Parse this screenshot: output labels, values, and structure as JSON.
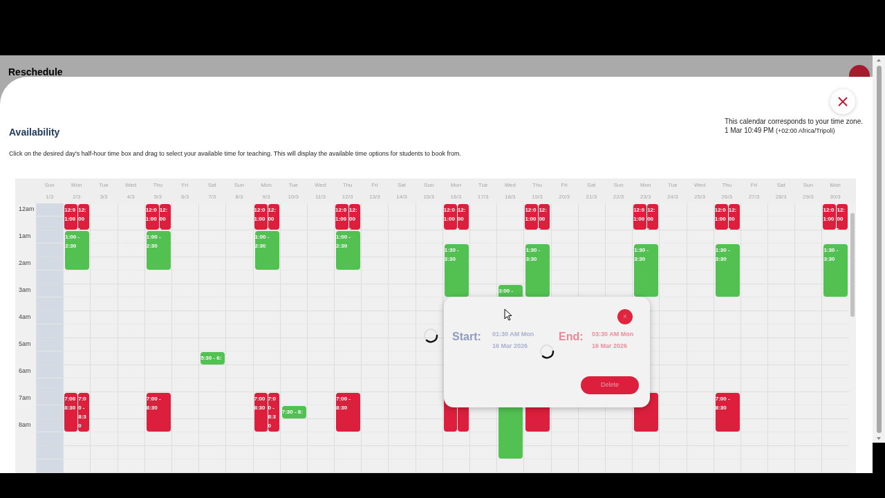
{
  "backdrop": {
    "title": "Reschedule"
  },
  "modal": {
    "heading": "Availability",
    "instructions": "Click on the desired day's half-hour time box and drag to select your available time for teaching. This will display the available time options for students to book from.",
    "timezone_note": "This calendar corresponds to your time zone.",
    "current_time": "1 Mar 10:49 PM",
    "timezone": "(+02:00 Africa/Tripoli)"
  },
  "hours": [
    "12am",
    "1am",
    "2am",
    "3am",
    "4am",
    "5am",
    "6am",
    "7am",
    "8am"
  ],
  "days": [
    {
      "name": "Sun",
      "date": "1/3",
      "past": true
    },
    {
      "name": "Mon",
      "date": "2/3",
      "past": false,
      "slots": [
        {
          "kind": "pair",
          "parts": [
            {
              "lines": [
                "12:0",
                "1:00"
              ]
            },
            {
              "lines": [
                "12:",
                "00",
                "-"
              ]
            }
          ]
        },
        {
          "kind": "cont"
        },
        {
          "kind": "available",
          "lines": [
            "1:00 -",
            "2:30"
          ]
        },
        {
          "kind": "cont"
        },
        {
          "kind": "cont"
        },
        {
          "kind": "free"
        },
        {
          "kind": "free"
        },
        {
          "kind": "free"
        },
        {
          "kind": "free"
        },
        {
          "kind": "free"
        },
        {
          "kind": "free"
        },
        {
          "kind": "free"
        },
        {
          "kind": "free"
        },
        {
          "kind": "free"
        },
        {
          "kind": "pair",
          "parts": [
            {
              "lines": [
                "7:00",
                "8:30"
              ]
            },
            {
              "lines": [
                "7:0",
                "0 -",
                "8:3",
                "0"
              ]
            }
          ]
        },
        {
          "kind": "cont"
        },
        {
          "kind": "cont"
        }
      ]
    },
    {
      "name": "Tue",
      "date": "3/3",
      "past": false
    },
    {
      "name": "Wed",
      "date": "4/3",
      "past": false
    },
    {
      "name": "Thu",
      "date": "5/3",
      "past": false,
      "slots": [
        {
          "kind": "pair",
          "parts": [
            {
              "lines": [
                "12:0",
                "1:00"
              ]
            },
            {
              "lines": [
                "12:",
                "00",
                "-"
              ]
            }
          ]
        },
        {
          "kind": "cont"
        },
        {
          "kind": "available",
          "lines": [
            "1:00 -",
            "2:30"
          ]
        },
        {
          "kind": "cont"
        },
        {
          "kind": "cont"
        },
        {
          "kind": "free"
        },
        {
          "kind": "free"
        },
        {
          "kind": "free"
        },
        {
          "kind": "free"
        },
        {
          "kind": "free"
        },
        {
          "kind": "free"
        },
        {
          "kind": "free"
        },
        {
          "kind": "free"
        },
        {
          "kind": "free"
        },
        {
          "kind": "booked",
          "lines": [
            "7:00 -",
            "8:30"
          ]
        },
        {
          "kind": "cont"
        },
        {
          "kind": "cont"
        }
      ]
    },
    {
      "name": "Fri",
      "date": "6/3",
      "past": false
    },
    {
      "name": "Sat",
      "date": "7/3",
      "past": false,
      "slots": [
        {
          "kind": "free"
        },
        {
          "kind": "free"
        },
        {
          "kind": "free"
        },
        {
          "kind": "free"
        },
        {
          "kind": "free"
        },
        {
          "kind": "free"
        },
        {
          "kind": "free"
        },
        {
          "kind": "free"
        },
        {
          "kind": "free"
        },
        {
          "kind": "free"
        },
        {
          "kind": "free"
        },
        {
          "kind": "available",
          "lines": [
            "5:30 - 6:"
          ]
        }
      ]
    },
    {
      "name": "Sun",
      "date": "8/3",
      "past": false
    },
    {
      "name": "Mon",
      "date": "9/3",
      "past": false,
      "slots": [
        {
          "kind": "pair",
          "parts": [
            {
              "lines": [
                "12:0",
                "1:00"
              ]
            },
            {
              "lines": [
                "12:",
                "00",
                "-"
              ]
            }
          ]
        },
        {
          "kind": "cont"
        },
        {
          "kind": "available",
          "lines": [
            "1:00 -",
            "2:30"
          ]
        },
        {
          "kind": "cont"
        },
        {
          "kind": "cont"
        },
        {
          "kind": "free"
        },
        {
          "kind": "free"
        },
        {
          "kind": "free"
        },
        {
          "kind": "free"
        },
        {
          "kind": "free"
        },
        {
          "kind": "free"
        },
        {
          "kind": "free"
        },
        {
          "kind": "free"
        },
        {
          "kind": "free"
        },
        {
          "kind": "pair",
          "parts": [
            {
              "lines": [
                "7:00",
                "8:30"
              ]
            },
            {
              "lines": [
                "7:0",
                "0 -",
                "8:3",
                "0"
              ]
            }
          ]
        },
        {
          "kind": "cont"
        },
        {
          "kind": "cont"
        }
      ]
    },
    {
      "name": "Tue",
      "date": "10/3",
      "past": false,
      "slots": [
        {
          "kind": "free"
        },
        {
          "kind": "free"
        },
        {
          "kind": "free"
        },
        {
          "kind": "free"
        },
        {
          "kind": "free"
        },
        {
          "kind": "free"
        },
        {
          "kind": "free"
        },
        {
          "kind": "free"
        },
        {
          "kind": "free"
        },
        {
          "kind": "free"
        },
        {
          "kind": "free"
        },
        {
          "kind": "free"
        },
        {
          "kind": "free"
        },
        {
          "kind": "free"
        },
        {
          "kind": "free"
        },
        {
          "kind": "available",
          "lines": [
            "7:30 - 8:"
          ]
        }
      ]
    },
    {
      "name": "Wed",
      "date": "11/3",
      "past": false
    },
    {
      "name": "Thu",
      "date": "12/3",
      "past": false,
      "slots": [
        {
          "kind": "pair",
          "parts": [
            {
              "lines": [
                "12:0",
                "1:00"
              ]
            },
            {
              "lines": [
                "12:",
                "00",
                "-"
              ]
            }
          ]
        },
        {
          "kind": "cont"
        },
        {
          "kind": "available",
          "lines": [
            "1:00 -",
            "2:30"
          ]
        },
        {
          "kind": "cont"
        },
        {
          "kind": "cont"
        },
        {
          "kind": "free"
        },
        {
          "kind": "free"
        },
        {
          "kind": "free"
        },
        {
          "kind": "free"
        },
        {
          "kind": "free"
        },
        {
          "kind": "free"
        },
        {
          "kind": "free"
        },
        {
          "kind": "free"
        },
        {
          "kind": "free"
        },
        {
          "kind": "booked",
          "lines": [
            "7:00 -",
            "8:30"
          ]
        },
        {
          "kind": "cont"
        },
        {
          "kind": "cont"
        }
      ]
    },
    {
      "name": "Fri",
      "date": "13/3",
      "past": false
    },
    {
      "name": "Sat",
      "date": "14/3",
      "past": false
    },
    {
      "name": "Sun",
      "date": "15/3",
      "past": false
    },
    {
      "name": "Mon",
      "date": "16/3",
      "past": false,
      "slots": [
        {
          "kind": "pair",
          "parts": [
            {
              "lines": [
                "12:0",
                "1:00"
              ]
            },
            {
              "lines": [
                "12:",
                "00",
                "-"
              ]
            }
          ]
        },
        {
          "kind": "cont"
        },
        {
          "kind": "free"
        },
        {
          "kind": "available",
          "lines": [
            "1:30 -",
            "3:30"
          ]
        },
        {
          "kind": "cont"
        },
        {
          "kind": "cont"
        },
        {
          "kind": "cont"
        },
        {
          "kind": "free"
        },
        {
          "kind": "free"
        },
        {
          "kind": "free"
        },
        {
          "kind": "free"
        },
        {
          "kind": "free"
        },
        {
          "kind": "free"
        },
        {
          "kind": "free"
        },
        {
          "kind": "pair"
        },
        {
          "kind": "cont"
        },
        {
          "kind": "cont"
        }
      ]
    },
    {
      "name": "Tue",
      "date": "17/3",
      "past": false
    },
    {
      "name": "Wed",
      "date": "18/3",
      "past": false,
      "slots": [
        {
          "kind": "free"
        },
        {
          "kind": "free"
        },
        {
          "kind": "free"
        },
        {
          "kind": "free"
        },
        {
          "kind": "free"
        },
        {
          "kind": "free"
        },
        {
          "kind": "available",
          "lines": [
            "3:00 -"
          ]
        },
        {
          "kind": "cont"
        },
        {
          "kind": "cont"
        },
        {
          "kind": "cont"
        },
        {
          "kind": "free"
        },
        {
          "kind": "free"
        },
        {
          "kind": "free"
        },
        {
          "kind": "free"
        },
        {
          "kind": "free"
        },
        {
          "kind": "available"
        },
        {
          "kind": "cont"
        },
        {
          "kind": "cont"
        },
        {
          "kind": "cont"
        }
      ]
    },
    {
      "name": "Thu",
      "date": "19/3",
      "past": false,
      "slots": [
        {
          "kind": "pair",
          "parts": [
            {
              "lines": [
                "12:0",
                "1:00"
              ]
            },
            {
              "lines": [
                "12:",
                "00",
                "-"
              ]
            }
          ]
        },
        {
          "kind": "cont"
        },
        {
          "kind": "free"
        },
        {
          "kind": "available",
          "lines": [
            "1:30 -",
            "3:30"
          ]
        },
        {
          "kind": "cont"
        },
        {
          "kind": "cont"
        },
        {
          "kind": "cont"
        },
        {
          "kind": "free"
        },
        {
          "kind": "free"
        },
        {
          "kind": "free"
        },
        {
          "kind": "free"
        },
        {
          "kind": "free"
        },
        {
          "kind": "free"
        },
        {
          "kind": "free"
        },
        {
          "kind": "booked"
        },
        {
          "kind": "cont"
        },
        {
          "kind": "cont"
        }
      ]
    },
    {
      "name": "Fri",
      "date": "20/3",
      "past": false
    },
    {
      "name": "Sat",
      "date": "21/3",
      "past": false
    },
    {
      "name": "Sun",
      "date": "22/3",
      "past": false
    },
    {
      "name": "Mon",
      "date": "23/3",
      "past": false,
      "slots": [
        {
          "kind": "pair",
          "parts": [
            {
              "lines": [
                "12:0",
                "1:00"
              ]
            },
            {
              "lines": [
                "12:",
                "00",
                "-"
              ]
            }
          ]
        },
        {
          "kind": "cont"
        },
        {
          "kind": "free"
        },
        {
          "kind": "available",
          "lines": [
            "1:30 -",
            "3:30"
          ]
        },
        {
          "kind": "cont"
        },
        {
          "kind": "cont"
        },
        {
          "kind": "cont"
        },
        {
          "kind": "free"
        },
        {
          "kind": "free"
        },
        {
          "kind": "free"
        },
        {
          "kind": "free"
        },
        {
          "kind": "free"
        },
        {
          "kind": "free"
        },
        {
          "kind": "free"
        },
        {
          "kind": "booked"
        },
        {
          "kind": "cont"
        },
        {
          "kind": "cont"
        }
      ]
    },
    {
      "name": "Tue",
      "date": "24/3",
      "past": false
    },
    {
      "name": "Wed",
      "date": "25/3",
      "past": false
    },
    {
      "name": "Thu",
      "date": "26/3",
      "past": false,
      "slots": [
        {
          "kind": "pair",
          "parts": [
            {
              "lines": [
                "12:0",
                "1:00"
              ]
            },
            {
              "lines": [
                "12:",
                "00",
                "-"
              ]
            }
          ]
        },
        {
          "kind": "cont"
        },
        {
          "kind": "free"
        },
        {
          "kind": "available",
          "lines": [
            "1:30 -",
            "3:30"
          ]
        },
        {
          "kind": "cont"
        },
        {
          "kind": "cont"
        },
        {
          "kind": "cont"
        },
        {
          "kind": "free"
        },
        {
          "kind": "free"
        },
        {
          "kind": "free"
        },
        {
          "kind": "free"
        },
        {
          "kind": "free"
        },
        {
          "kind": "free"
        },
        {
          "kind": "free"
        },
        {
          "kind": "booked",
          "lines": [
            "7:00 -",
            "8:30"
          ]
        },
        {
          "kind": "cont"
        },
        {
          "kind": "cont"
        }
      ]
    },
    {
      "name": "Fri",
      "date": "27/3",
      "past": false
    },
    {
      "name": "Sat",
      "date": "28/3",
      "past": false
    },
    {
      "name": "Sun",
      "date": "29/3",
      "past": false
    },
    {
      "name": "Mon",
      "date": "30/3",
      "past": false,
      "slots": [
        {
          "kind": "pair",
          "parts": [
            {
              "lines": [
                "12:0",
                "1:00"
              ]
            },
            {
              "lines": [
                "12:",
                "00",
                "-"
              ]
            }
          ]
        },
        {
          "kind": "cont"
        },
        {
          "kind": "free"
        },
        {
          "kind": "available",
          "lines": [
            "1:30 -",
            "3:30"
          ]
        },
        {
          "kind": "cont"
        },
        {
          "kind": "cont"
        },
        {
          "kind": "cont"
        }
      ]
    }
  ],
  "popup": {
    "start_label": "Start:",
    "start_value": "01:30 AM Mon 16 Mar 2026",
    "end_label": "End:",
    "end_value": "03:30 AM Mon 16 Mar 2026",
    "close": "×",
    "action": "Delete"
  }
}
